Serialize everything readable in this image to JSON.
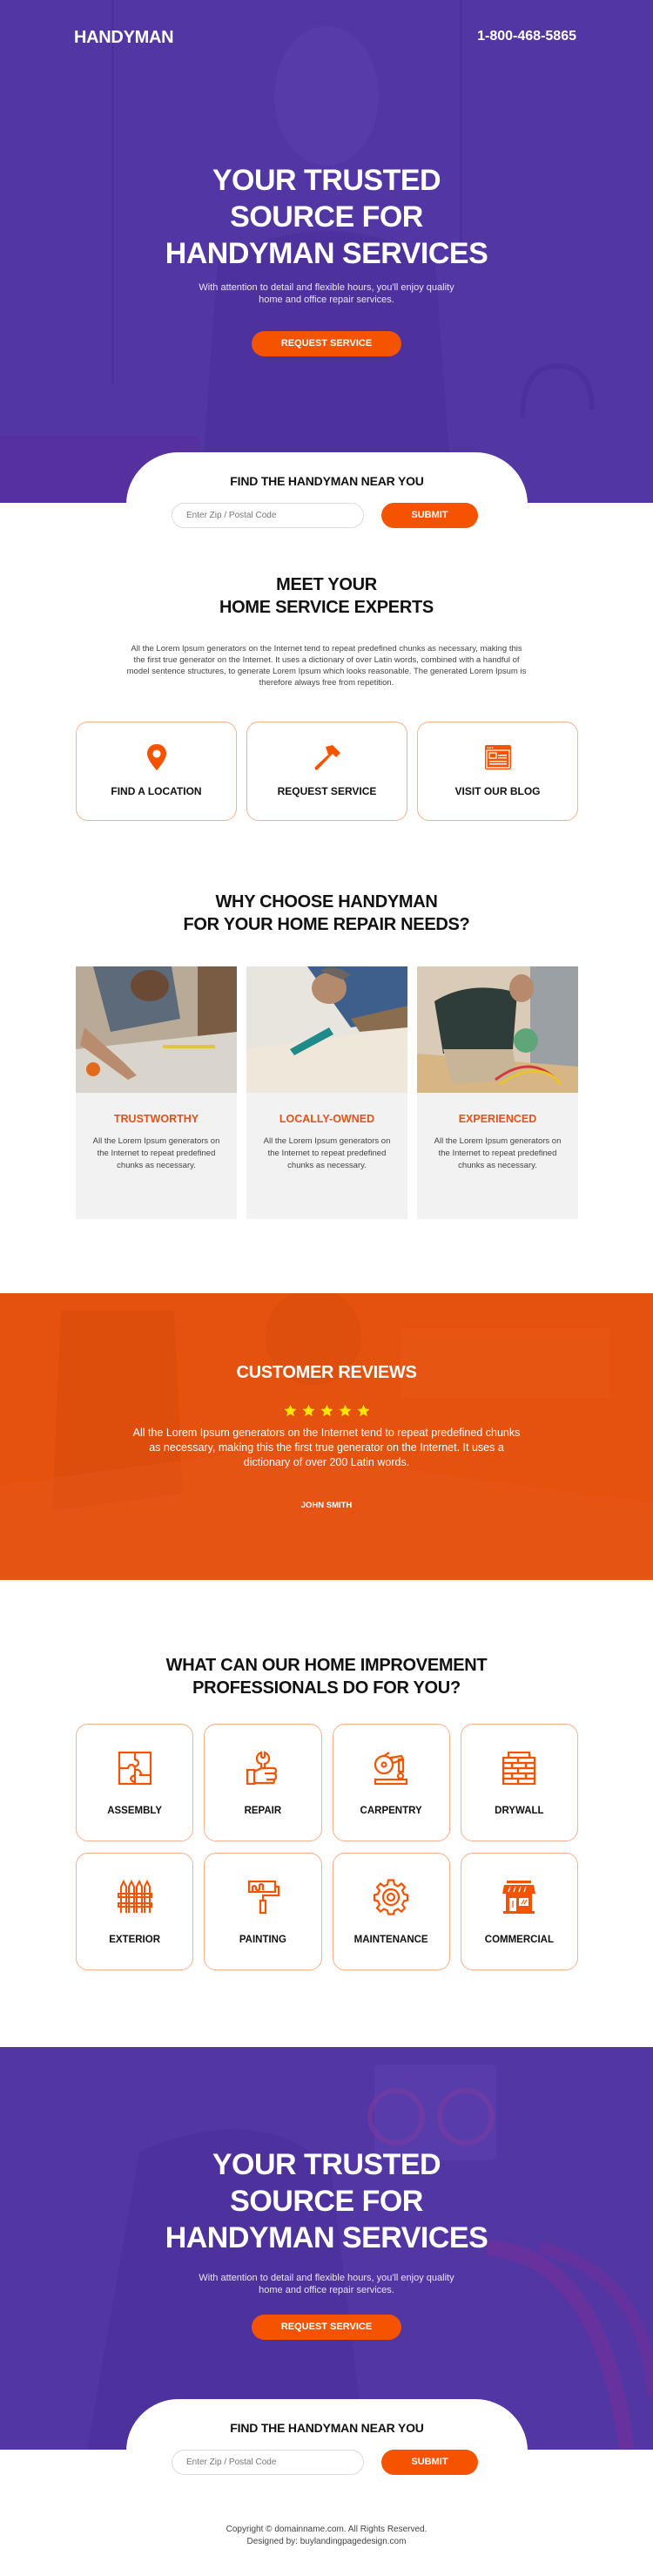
{
  "colors": {
    "purple": "#5236a3",
    "orange": "#f55300",
    "reviews_bg": "#e4520e",
    "heading_orange": "#e8501a",
    "card_border": "#f7b08c",
    "star": "#ffe600"
  },
  "header": {
    "brand": "HANDYMAN",
    "phone": "1-800-468-5865"
  },
  "hero": {
    "title_lines": [
      "YOUR TRUSTED",
      "SOURCE FOR",
      "HANDYMAN SERVICES"
    ],
    "subtitle_lines": [
      "With attention to detail and flexible hours, you'll enjoy quality",
      "home and office repair services."
    ],
    "cta_label": "REQUEST SERVICE"
  },
  "finder": {
    "title": "FIND THE HANDYMAN NEAR YOU",
    "zip_placeholder": "Enter Zip / Postal Code",
    "zip_value": "",
    "submit_label": "SUBMIT"
  },
  "meet": {
    "title_lines": [
      "MEET YOUR",
      "HOME SERVICE EXPERTS"
    ],
    "text": "All the Lorem Ipsum generators on the Internet tend to repeat predefined chunks as necessary, making this the first true generator on the Internet. It uses a dictionary of over Latin words, combined with a handful of model sentence structures, to generate Lorem Ipsum which looks reasonable. The generated Lorem Ipsum is therefore always free from repetition.",
    "actions": [
      {
        "label": "FIND A LOCATION",
        "icon": "map-pin-icon"
      },
      {
        "label": "REQUEST SERVICE",
        "icon": "hammer-icon"
      },
      {
        "label": "VISIT OUR BLOG",
        "icon": "browser-window-icon"
      }
    ]
  },
  "why": {
    "title_lines": [
      "WHY CHOOSE HANDYMAN",
      "FOR YOUR HOME REPAIR NEEDS?"
    ],
    "cards": [
      {
        "title": "TRUSTWORTHY",
        "text": "All the Lorem Ipsum generators on the Internet to repeat predefined chunks as necessary.",
        "image": "carpenter measuring wood photo"
      },
      {
        "title": "LOCALLY-OWNED",
        "text": "All the Lorem Ipsum generators on the Internet to repeat predefined chunks as necessary.",
        "image": "man installing carpet photo"
      },
      {
        "title": "EXPERIENCED",
        "text": "All the Lorem Ipsum generators on the Internet to repeat predefined chunks as necessary.",
        "image": "technician servicing AC unit photo"
      }
    ]
  },
  "reviews": {
    "title": "CUSTOMER REVIEWS",
    "rating": 5,
    "rating_max": 5,
    "quote": "All the Lorem Ipsum generators on the Internet tend to repeat predefined chunks as necessary, making this the first true generator on the Internet. It uses a dictionary of over 200 Latin words.",
    "author": "JOHN SMITH"
  },
  "services": {
    "title_lines": [
      "WHAT CAN OUR HOME IMPROVEMENT",
      "PROFESSIONALS DO FOR YOU?"
    ],
    "items": [
      {
        "label": "ASSEMBLY",
        "icon": "puzzle-icon"
      },
      {
        "label": "REPAIR",
        "icon": "wrench-hand-icon"
      },
      {
        "label": "CARPENTRY",
        "icon": "circular-saw-icon"
      },
      {
        "label": "DRYWALL",
        "icon": "brick-wall-icon"
      },
      {
        "label": "EXTERIOR",
        "icon": "fence-icon"
      },
      {
        "label": "PAINTING",
        "icon": "paint-roller-icon"
      },
      {
        "label": "MAINTENANCE",
        "icon": "gear-icon"
      },
      {
        "label": "COMMERCIAL",
        "icon": "storefront-icon"
      }
    ]
  },
  "footer": {
    "copyright": "Copyright © domainname.com. All Rights Reserved.",
    "designed_by": "Designed by: buylandingpagedesign.com"
  }
}
